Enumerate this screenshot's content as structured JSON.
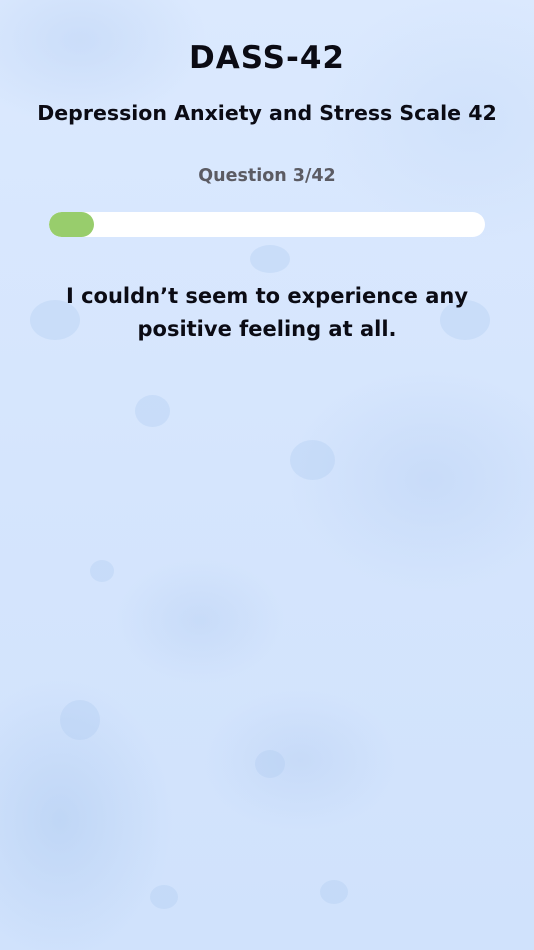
{
  "header": {
    "title": "DASS-42",
    "subtitle": "Depression Anxiety and Stress Scale 42"
  },
  "progress": {
    "counter_text": "Question 3/42",
    "fraction": 0.103
  },
  "question": {
    "text": "I couldn’t seem to experience any positive feeling at all."
  },
  "colors": {
    "background": "#d6e6fd",
    "progress_fill": "#98cd6c",
    "progress_track": "#ffffff",
    "text": "#0b0b14",
    "counter_text": "#5b5b63"
  }
}
